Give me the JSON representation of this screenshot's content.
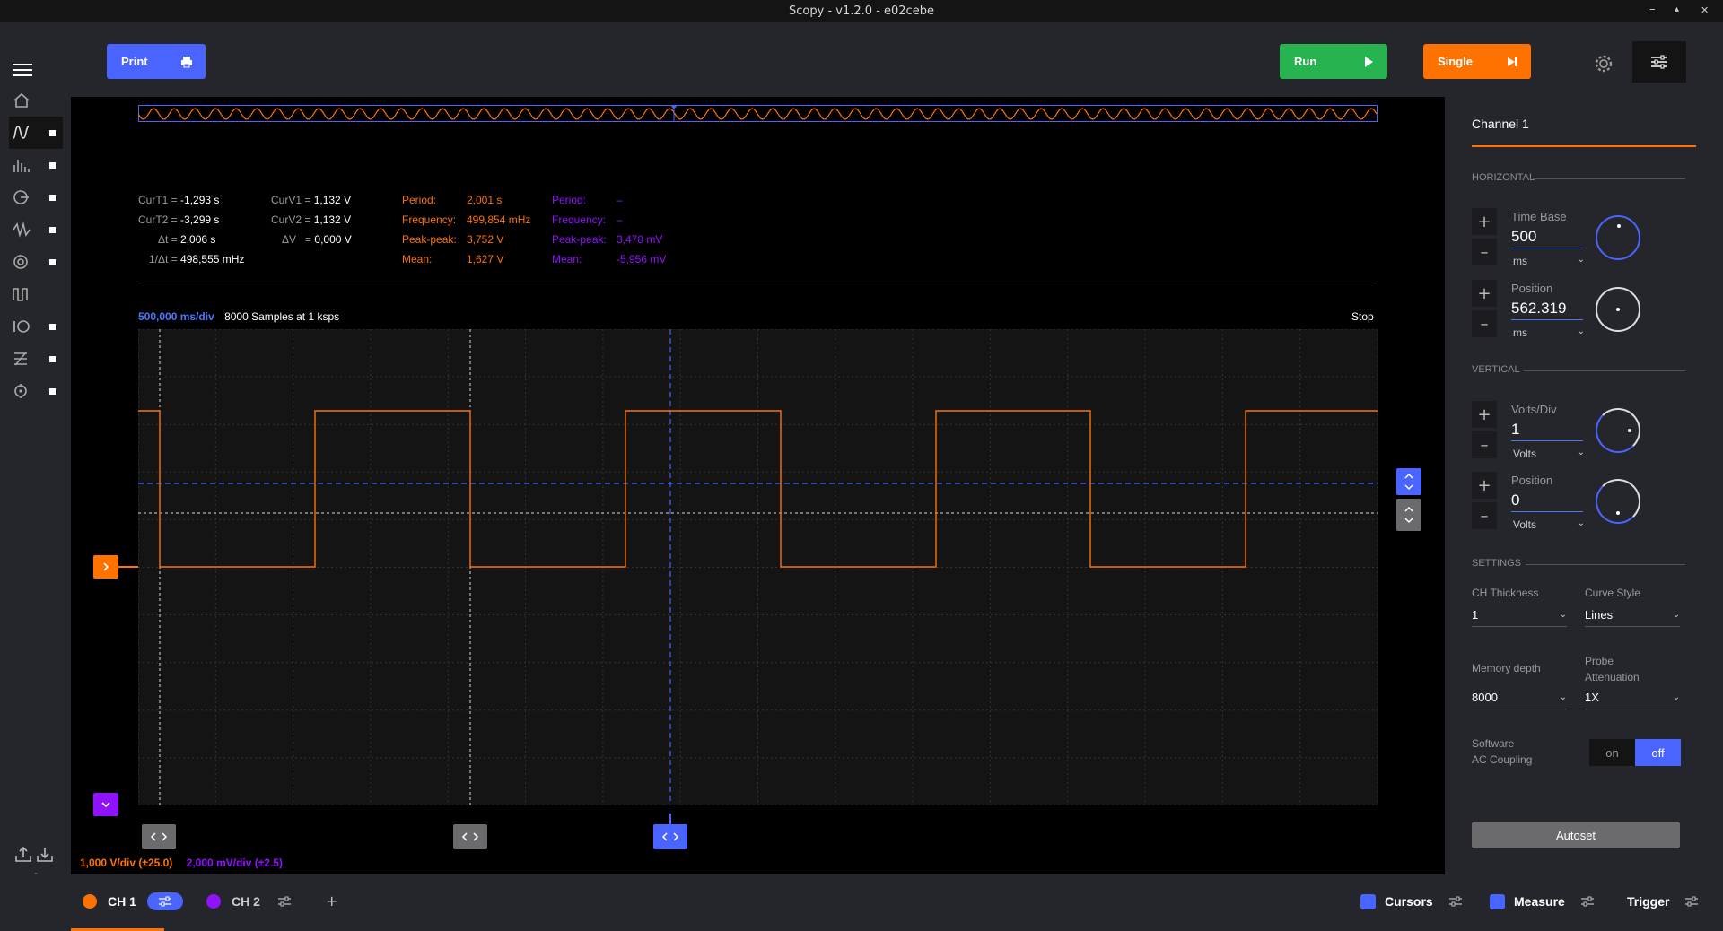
{
  "window": {
    "title": "Scopy - v1.2.0 - e02cebe",
    "minimize": "–",
    "maximize": "▴",
    "close": "✕"
  },
  "toolbar": {
    "print_label": "Print",
    "run_label": "Run",
    "single_label": "Single"
  },
  "sidebar": {
    "tools": [
      "home",
      "oscilloscope",
      "spectrum",
      "network",
      "signal-generator",
      "logic",
      "pattern",
      "digital-io",
      "power",
      "voltmeter"
    ]
  },
  "cursors": {
    "curt1_label": "CurT1 =",
    "curt1": "-1,293 s",
    "curt2_label": "CurT2 =",
    "curt2": "-3,299 s",
    "dt_label": "Δt =",
    "dt": "2,006 s",
    "inv_dt_label": "1/Δt =",
    "inv_dt": "498,555 mHz",
    "curv1_label": "CurV1 =",
    "curv1": "1,132 V",
    "curv2_label": "CurV2 =",
    "curv2": "1,132 V",
    "dv_label": "ΔV",
    "dv_eq": "=",
    "dv": "0,000 V"
  },
  "measure_ch1": {
    "period_label": "Period:",
    "period": "2,001 s",
    "freq_label": "Frequency:",
    "freq": "499,854 mHz",
    "pp_label": "Peak-peak:",
    "pp": "3,752 V",
    "mean_label": "Mean:",
    "mean": "1,627 V"
  },
  "measure_ch2": {
    "period_label": "Period:",
    "period": "–",
    "freq_label": "Frequency:",
    "freq": "–",
    "pp_label": "Peak-peak:",
    "pp": "3,478 mV",
    "mean_label": "Mean:",
    "mean": "-5,956 mV"
  },
  "plot": {
    "timebase": "500,000 ms/div",
    "samples": "8000 Samples at 1 ksps",
    "status": "Stop",
    "ch1_scale": "1,000 V/div (±25.0)",
    "ch2_scale": "2,000 mV/div (±2.5)"
  },
  "panel": {
    "title": "Channel 1",
    "horizontal": "HORIZONTAL",
    "timebase_label": "Time Base",
    "timebase_value": "500",
    "timebase_unit": "ms",
    "hpos_label": "Position",
    "hpos_value": "562.319",
    "hpos_unit": "ms",
    "vertical": "VERTICAL",
    "vdiv_label": "Volts/Div",
    "vdiv_value": "1",
    "vdiv_unit": "Volts",
    "vpos_label": "Position",
    "vpos_value": "0",
    "vpos_unit": "Volts",
    "settings": "SETTINGS",
    "thickness_label": "CH Thickness",
    "thickness_value": "1",
    "curve_label": "Curve Style",
    "curve_value": "Lines",
    "memdepth_label": "Memory depth",
    "memdepth_value": "8000",
    "probe_label_1": "Probe",
    "probe_label_2": "Attenuation",
    "probe_value": "1X",
    "acc_label_1": "Software",
    "acc_label_2": "AC Coupling",
    "on": "on",
    "off": "off",
    "autoset": "Autoset",
    "plus": "+",
    "minus": "–"
  },
  "bottom": {
    "ch1": "CH 1",
    "ch2": "CH 2",
    "add": "+",
    "cursors": "Cursors",
    "measure": "Measure",
    "trigger": "Trigger"
  },
  "colors": {
    "ch1": "#ff7200",
    "ch2": "#9013fe",
    "accent": "#4a64ff",
    "run": "#27b34f"
  }
}
